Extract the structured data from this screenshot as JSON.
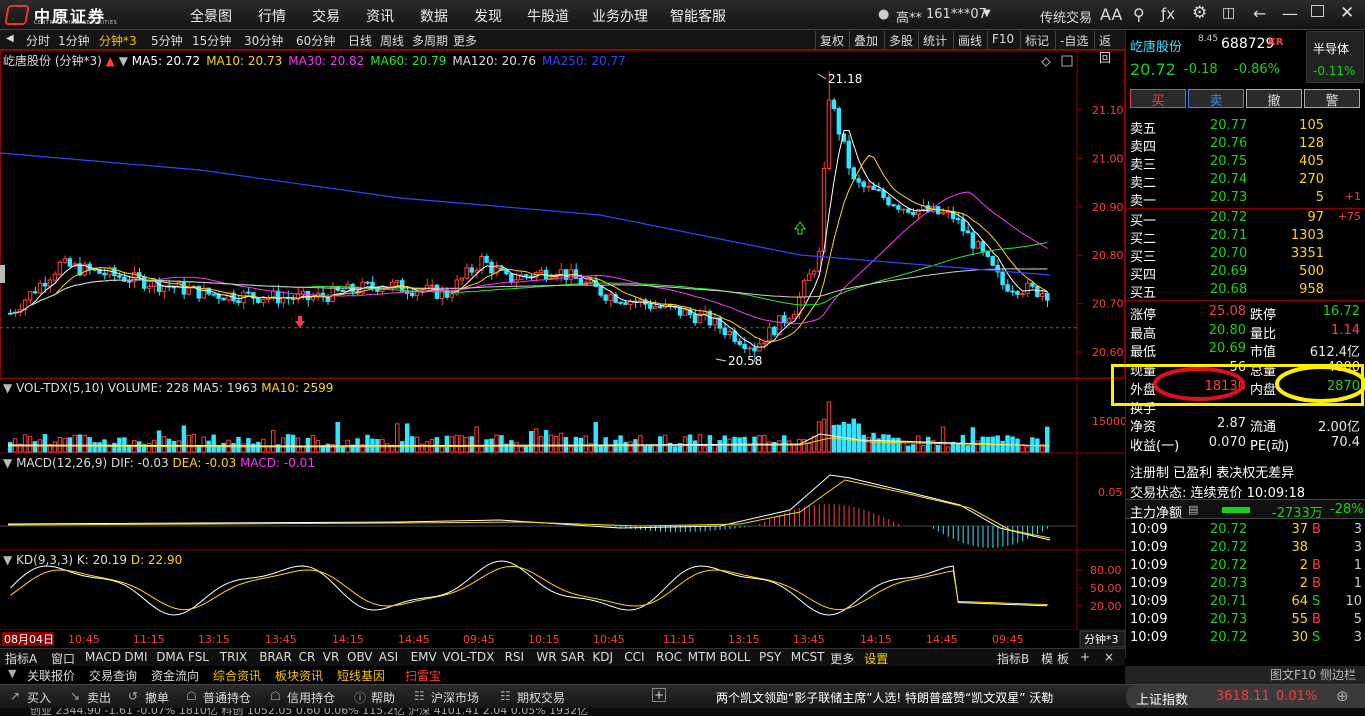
{
  "topbar": {
    "logo_cn": "中原证券",
    "logo_en": "CENTRAL CHINA SECURITIES",
    "menu": [
      "全景图",
      "行情",
      "交易",
      "资讯",
      "数据",
      "发现",
      "牛股道",
      "业务办理",
      "智能客服"
    ],
    "user": "高**",
    "account": "161***07",
    "trade_mode": "传统交易",
    "font_size_label": "AA"
  },
  "period_toolbar": {
    "periods": [
      "分时",
      "1分钟",
      "分钟*3",
      "5分钟",
      "15分钟",
      "30分钟",
      "60分钟",
      "日线",
      "周线",
      "多周期",
      "更多"
    ],
    "active": "分钟*3",
    "right_buttons": [
      "复权",
      "叠加",
      "多股",
      "统计",
      "画线",
      "F10",
      "标记",
      "-自选",
      "返回"
    ]
  },
  "chart_header": {
    "stock_label": "屹唐股份 (分钟*3)",
    "ma": [
      {
        "label": "MA5: 20.72",
        "color": "#ffffff"
      },
      {
        "label": "MA10: 20.73",
        "color": "#ffd700"
      },
      {
        "label": "MA30: 20.82",
        "color": "#ff33ff"
      },
      {
        "label": "MA60: 20.79",
        "color": "#22ee22"
      },
      {
        "label": "MA120: 20.76",
        "color": "#dddddd"
      },
      {
        "label": "MA250: 20.77",
        "color": "#3344ff"
      }
    ]
  },
  "price_axis": [
    "21.10",
    "21.00",
    "20.90",
    "20.80",
    "20.70",
    "20.60"
  ],
  "annotations": {
    "high": "21.18",
    "low": "20.58"
  },
  "volume_panel": {
    "label": "VOL-TDX(5,10)",
    "volume": "VOLUME: 228",
    "ma5": "MA5: 1963",
    "ma10": "MA10: 2599",
    "axis": "15000"
  },
  "macd_panel": {
    "label": "MACD(12,26,9)",
    "dif": "DIF: -0.03",
    "dea": "DEA: -0.03",
    "macd": "MACD: -0.01",
    "axis": "0.05"
  },
  "kd_panel": {
    "label": "KD(9,3,3)",
    "k": "K: 20.19",
    "d": "D: 22.90",
    "axis": [
      "80.00",
      "50.00",
      "20.00"
    ]
  },
  "time_axis": {
    "date": "08月04日",
    "labels": [
      "10:45",
      "11:15",
      "13:15",
      "13:45",
      "14:15",
      "14:45",
      "09:45",
      "10:15",
      "10:45",
      "11:15",
      "13:15",
      "13:45",
      "14:15",
      "14:45",
      "09:45"
    ],
    "period_tag": "分钟*3"
  },
  "indicator_tabs": [
    "指标A",
    "窗口",
    "MACD",
    "DMI",
    "DMA",
    "FSL",
    "TRIX",
    "BRAR",
    "CR",
    "VR",
    "OBV",
    "ASI",
    "EMV",
    "VOL-TDX",
    "RSI",
    "WR",
    "SAR",
    "KDJ",
    "CCI",
    "ROC",
    "MTM",
    "BOLL",
    "PSY",
    "MCST",
    "更多",
    "设置"
  ],
  "indicator_right": [
    "指标B",
    "模",
    "板"
  ],
  "bar3": [
    "关联报价",
    "交易查询",
    "资金流向",
    "综合资讯",
    "板块资讯",
    "短线基因",
    "扫雷宝"
  ],
  "bar4": {
    "left": [
      "买入",
      "卖出",
      "撤单",
      "普通持仓",
      "信用持仓",
      "帮助",
      "沪深市场",
      "期权交易"
    ],
    "news": "两个凯文领跑“影子联储主席”人选! 特朗普盛赞“凯文双星” 沃勒",
    "index_name": "上证指数",
    "index_value": "3618.11",
    "index_change": "0.01%"
  },
  "bar5": "创业  2344.90  -1.61  -0.07%  1810亿  科创  1052.05  0.60  0.06%  115.2亿  沪深  4101.41  2.04  0.05%  1932亿",
  "quote": {
    "name": "屹唐股份",
    "superscript": "8.45",
    "code": "688729",
    "kr": "KR",
    "sector": "半导体",
    "sector_change": "-0.11%",
    "price": "20.72",
    "change": "-0.18",
    "change_pct": "-0.86%",
    "actions": [
      "买",
      "卖",
      "撤",
      "警"
    ],
    "asks": [
      {
        "label": "卖五",
        "price": "20.77",
        "vol": "105",
        "delta": ""
      },
      {
        "label": "卖四",
        "price": "20.76",
        "vol": "128",
        "delta": ""
      },
      {
        "label": "卖三",
        "price": "20.75",
        "vol": "405",
        "delta": ""
      },
      {
        "label": "卖二",
        "price": "20.74",
        "vol": "270",
        "delta": ""
      },
      {
        "label": "卖一",
        "price": "20.73",
        "vol": "5",
        "delta": "+1"
      }
    ],
    "bids": [
      {
        "label": "买一",
        "price": "20.72",
        "vol": "97",
        "delta": "+75"
      },
      {
        "label": "买二",
        "price": "20.71",
        "vol": "1303",
        "delta": ""
      },
      {
        "label": "买三",
        "price": "20.70",
        "vol": "3351",
        "delta": ""
      },
      {
        "label": "买四",
        "price": "20.69",
        "vol": "500",
        "delta": ""
      },
      {
        "label": "买五",
        "price": "20.68",
        "vol": "958",
        "delta": ""
      }
    ],
    "stats": [
      {
        "l1": "涨停",
        "v1": "25.08",
        "c1": "red",
        "l2": "跌停",
        "v2": "16.72",
        "c2": "green"
      },
      {
        "l1": "最高",
        "v1": "20.80",
        "c1": "green",
        "l2": "量比",
        "v2": "1.14",
        "c2": "red"
      },
      {
        "l1": "最低",
        "v1": "20.69",
        "c1": "green",
        "l2": "市值",
        "v2": "612.4亿",
        "c2": "white"
      },
      {
        "l1": "现量",
        "v1": "56",
        "c1": "white",
        "l2": "总量",
        "v2": "4000",
        "c2": "white"
      },
      {
        "l1": "外盘",
        "v1": "18130",
        "c1": "red",
        "l2": "内盘",
        "v2": "2870",
        "c2": "green"
      },
      {
        "l1": "换手",
        "v1": "",
        "c1": "white",
        "l2": "",
        "v2": "",
        "c2": "white"
      },
      {
        "l1": "净资",
        "v1": "2.87",
        "c1": "white",
        "l2": "流通",
        "v2": "2.00亿",
        "c2": "white"
      },
      {
        "l1": "收益(一)",
        "v1": "0.070",
        "c1": "white",
        "l2": "PE(动)",
        "v2": "70.4",
        "c2": "white"
      }
    ],
    "tags": "注册制 已盈利 表决权无差异",
    "trade_status": "交易状态: 连续竞价 10:09:18",
    "main_net_label": "主力净额",
    "main_net_value": "-2733万",
    "main_net_pct": "-28%",
    "ticks": [
      {
        "t": "10:09",
        "p": "20.72",
        "v": "37",
        "s": "B",
        "n": "3"
      },
      {
        "t": "10:09",
        "p": "20.72",
        "v": "38",
        "s": "",
        "n": "3"
      },
      {
        "t": "10:09",
        "p": "20.72",
        "v": "2",
        "s": "B",
        "n": "1"
      },
      {
        "t": "10:09",
        "p": "20.73",
        "v": "2",
        "s": "B",
        "n": "1"
      },
      {
        "t": "10:09",
        "p": "20.71",
        "v": "64",
        "s": "S",
        "n": "10"
      },
      {
        "t": "10:09",
        "p": "20.73",
        "v": "55",
        "s": "B",
        "n": "5"
      },
      {
        "t": "10:09",
        "p": "20.72",
        "v": "30",
        "s": "S",
        "n": "3"
      }
    ]
  },
  "colors": {
    "up": "#ff3b3b",
    "down": "#2ee6ff",
    "bg": "#000000",
    "highlight": "#ffee00"
  }
}
